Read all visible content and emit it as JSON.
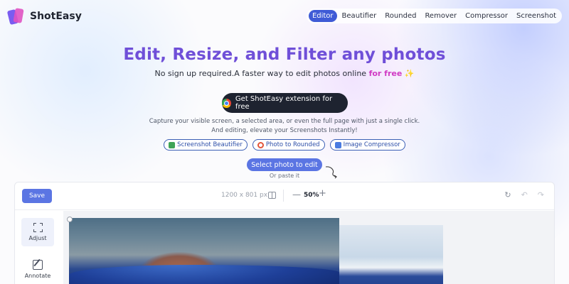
{
  "brand": {
    "name": "ShotEasy"
  },
  "nav": {
    "items": [
      {
        "label": "Editor",
        "active": true
      },
      {
        "label": "Beautifier",
        "active": false
      },
      {
        "label": "Rounded",
        "active": false
      },
      {
        "label": "Remover",
        "active": false
      },
      {
        "label": "Compressor",
        "active": false
      },
      {
        "label": "Screenshot",
        "active": false
      }
    ]
  },
  "hero": {
    "title": "Edit, Resize, and Filter any photos",
    "subtitle": "No sign up required.A faster way to edit photos online ",
    "subtitle_highlight": "for free",
    "subtitle_emoji": "✨",
    "extension_button": "Get ShotEasy extension for free",
    "description_line1": "Capture your visible screen, a selected area, or even the full page with just a single click.",
    "description_line2": "And editing, elevate your Screenshots Instantly!",
    "links": [
      {
        "label": "Screenshot Beautifier",
        "icon": "image-icon"
      },
      {
        "label": "Photo to Rounded",
        "icon": "lifebuoy-icon"
      },
      {
        "label": "Image Compressor",
        "icon": "download-icon"
      }
    ],
    "select_button": "Select photo to edit",
    "paste_hint": "Or paste it"
  },
  "editor": {
    "save_label": "Save",
    "dimensions": "1200 x 801 px",
    "zoom": "50%",
    "tools": [
      {
        "label": "Adjust",
        "icon": "adjust-icon",
        "active": true
      },
      {
        "label": "Annotate",
        "icon": "annotate-icon",
        "active": false
      }
    ]
  },
  "colors": {
    "accent": "#5b75e3",
    "nav_active": "#3f5bd6",
    "title": "#6f4fd8",
    "free_highlight": "#d03bc4",
    "dark_button": "#1e2330"
  }
}
